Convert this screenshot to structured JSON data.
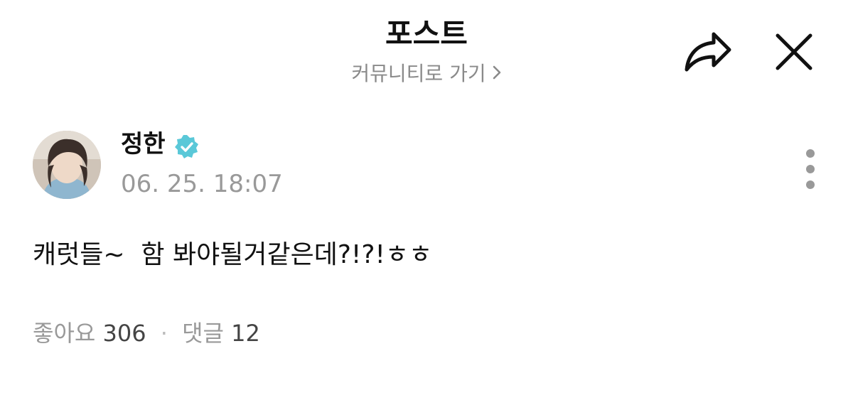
{
  "header": {
    "title": "포스트",
    "community_link": "커뮤니티로 가기",
    "community_link_icon": "chevron-right-icon",
    "share_icon": "share-arrow-icon",
    "close_icon": "close-icon"
  },
  "post": {
    "author": "정한",
    "verified_icon": "verified-badge-icon",
    "verified_color": "#5ac8d8",
    "timestamp": "06. 25. 18:07",
    "body": "캐럿들~  함 봐야될거같은데?!?!ㅎㅎ",
    "more_icon": "more-vertical-icon",
    "likes_label": "좋아요",
    "likes_count": "306",
    "separator": "·",
    "comments_label": "댓글",
    "comments_count": "12"
  }
}
